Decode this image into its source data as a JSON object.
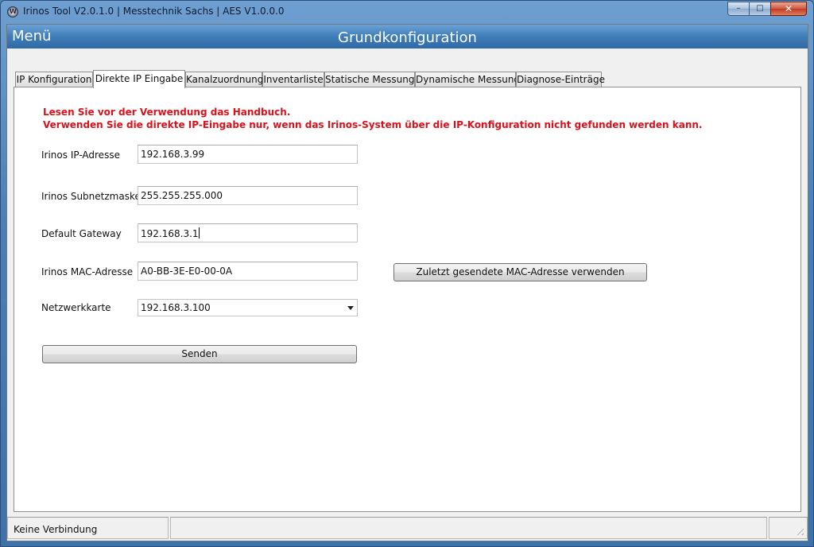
{
  "window": {
    "title": "Irinos Tool V2.0.1.0 | Messtechnik Sachs  | AES V1.0.0.0",
    "icon": "irinos-app-icon",
    "controls": {
      "minimize": "–",
      "maximize": "□",
      "close": "✕"
    }
  },
  "header": {
    "menu_label": "Menü",
    "title": "Grundkonfiguration"
  },
  "tabs": [
    {
      "label": "IP Konfiguration",
      "active": false
    },
    {
      "label": "Direkte IP Eingabe",
      "active": true
    },
    {
      "label": "Kanalzuordnung",
      "active": false
    },
    {
      "label": "Inventarliste",
      "active": false
    },
    {
      "label": "Statische Messung",
      "active": false
    },
    {
      "label": "Dynamische Messung",
      "active": false
    },
    {
      "label": "Diagnose-Einträge",
      "active": false
    }
  ],
  "warning": {
    "line1": "Lesen Sie vor der Verwendung das Handbuch.",
    "line2": "Verwenden Sie die direkte IP-Eingabe nur, wenn das Irinos-System über die IP-Konfiguration nicht gefunden werden kann.",
    "color": "#e0101a"
  },
  "form": {
    "ip": {
      "label": "Irinos IP-Adresse",
      "value": "192.168.3.99"
    },
    "subnet": {
      "label": "Irinos Subnetzmaske",
      "value": "255.255.255.000"
    },
    "gateway": {
      "label": "Default Gateway",
      "value": "192.168.3.1"
    },
    "mac": {
      "label": "Irinos MAC-Adresse",
      "value": "A0-BB-3E-E0-00-0A"
    },
    "nic": {
      "label": "Netzwerkkarte",
      "value": "192.168.3.100"
    },
    "mac_button": "Zuletzt gesendete MAC-Adresse verwenden",
    "send_button": "Senden"
  },
  "status": {
    "connection": "Keine Verbindung"
  },
  "colors": {
    "header_blue": "#3f7db9",
    "window_frame": "#4a7fb8"
  }
}
